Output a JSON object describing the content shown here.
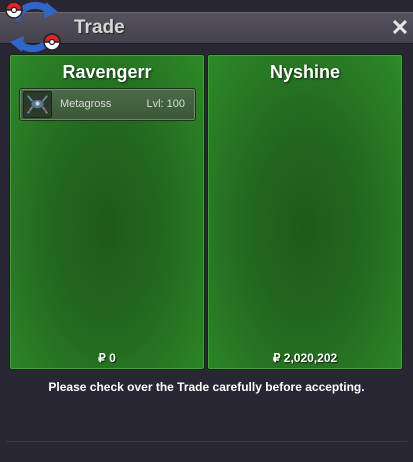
{
  "window": {
    "title": "Trade",
    "close_icon": "close-icon",
    "logo_icon": "trade-swap-icon"
  },
  "left_panel": {
    "trader_name": "Ravengerr",
    "items": [
      {
        "name": "Metagross",
        "level": "Lvl: 100",
        "icon": "metagross-sprite-icon"
      }
    ],
    "money": "₽ 0"
  },
  "right_panel": {
    "trader_name": "Nyshine",
    "items": [],
    "money": "₽ 2,020,202"
  },
  "notice": "Please check over the Trade carefully before accepting.",
  "colors": {
    "panel_green": "#23691f",
    "background": "#2a2734",
    "titlebar": "#4d4a55"
  }
}
